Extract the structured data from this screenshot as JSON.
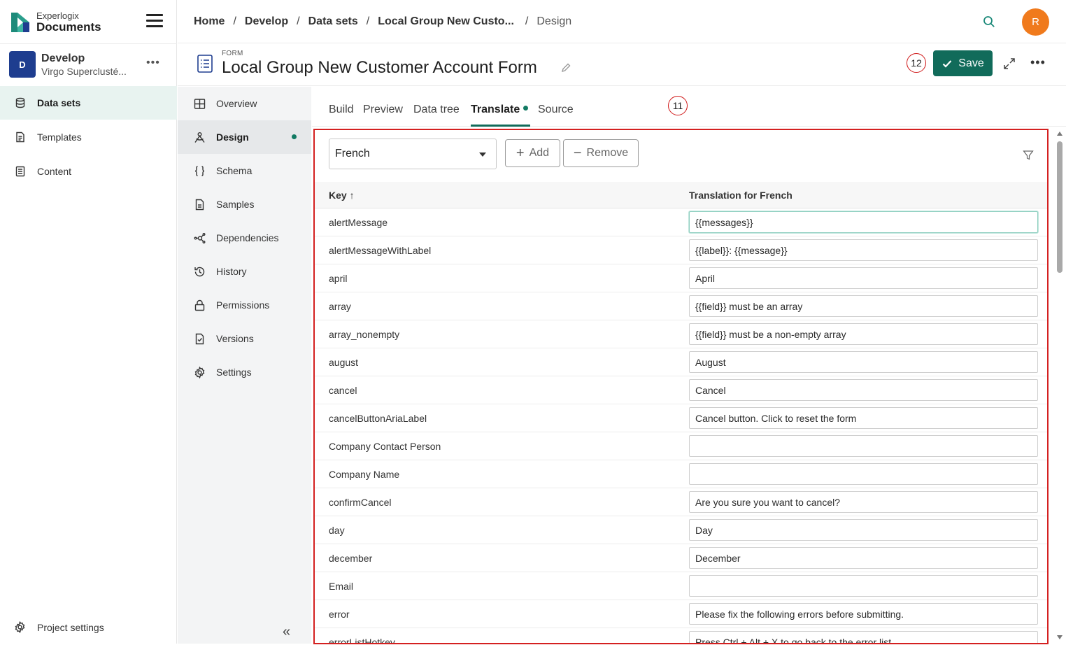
{
  "brand": {
    "small": "Experlogix",
    "big": "Documents"
  },
  "project": {
    "initial": "D",
    "name": "Develop",
    "subtitle": "Virgo Superclusté...",
    "more": "•••"
  },
  "sidebar": {
    "items": [
      {
        "label": "Data sets",
        "icon": "database-icon",
        "active": true
      },
      {
        "label": "Templates",
        "icon": "template-icon",
        "active": false
      },
      {
        "label": "Content",
        "icon": "content-icon",
        "active": false
      }
    ],
    "project_settings": "Project settings"
  },
  "breadcrumb": {
    "items": [
      "Home",
      "Develop",
      "Data sets",
      "Local Group New Custo..."
    ],
    "current": "Design"
  },
  "user": {
    "initial": "R"
  },
  "form": {
    "type_label": "FORM",
    "title": "Local Group New Customer Account Form",
    "save_label": "Save",
    "annotation_save": "12"
  },
  "subnav": {
    "items": [
      {
        "label": "Overview",
        "icon": "grid-icon"
      },
      {
        "label": "Design",
        "icon": "design-icon",
        "active": true
      },
      {
        "label": "Schema",
        "icon": "braces-icon"
      },
      {
        "label": "Samples",
        "icon": "document-icon"
      },
      {
        "label": "Dependencies",
        "icon": "network-icon"
      },
      {
        "label": "History",
        "icon": "history-icon"
      },
      {
        "label": "Permissions",
        "icon": "lock-icon"
      },
      {
        "label": "Versions",
        "icon": "versions-icon"
      },
      {
        "label": "Settings",
        "icon": "gear-icon"
      }
    ],
    "collapse": "«"
  },
  "tabs": {
    "items": [
      "Build",
      "Preview",
      "Data tree",
      "Translate",
      "Source"
    ],
    "active": "Translate",
    "annotation": "11"
  },
  "translate": {
    "language": "French",
    "add_label": "Add",
    "remove_label": "Remove",
    "col_key": "Key ↑",
    "col_translation": "Translation for French",
    "rows": [
      {
        "key": "alertMessage",
        "value": "{{messages}}"
      },
      {
        "key": "alertMessageWithLabel",
        "value": "{{label}}: {{message}}"
      },
      {
        "key": "april",
        "value": "April"
      },
      {
        "key": "array",
        "value": "{{field}} must be an array"
      },
      {
        "key": "array_nonempty",
        "value": "{{field}} must be a non-empty array"
      },
      {
        "key": "august",
        "value": "August"
      },
      {
        "key": "cancel",
        "value": "Cancel"
      },
      {
        "key": "cancelButtonAriaLabel",
        "value": "Cancel button. Click to reset the form"
      },
      {
        "key": "Company Contact Person",
        "value": ""
      },
      {
        "key": "Company Name",
        "value": ""
      },
      {
        "key": "confirmCancel",
        "value": "Are you sure you want to cancel?"
      },
      {
        "key": "day",
        "value": "Day"
      },
      {
        "key": "december",
        "value": "December"
      },
      {
        "key": "Email",
        "value": ""
      },
      {
        "key": "error",
        "value": "Please fix the following errors before submitting."
      },
      {
        "key": "errorListHotkey",
        "value": "Press Ctrl + Alt + X to go back to the error list."
      }
    ]
  },
  "colors": {
    "accent": "#116b5a",
    "annotation": "#d42020",
    "avatar": "#f07a1c",
    "project": "#1e3d8f"
  }
}
